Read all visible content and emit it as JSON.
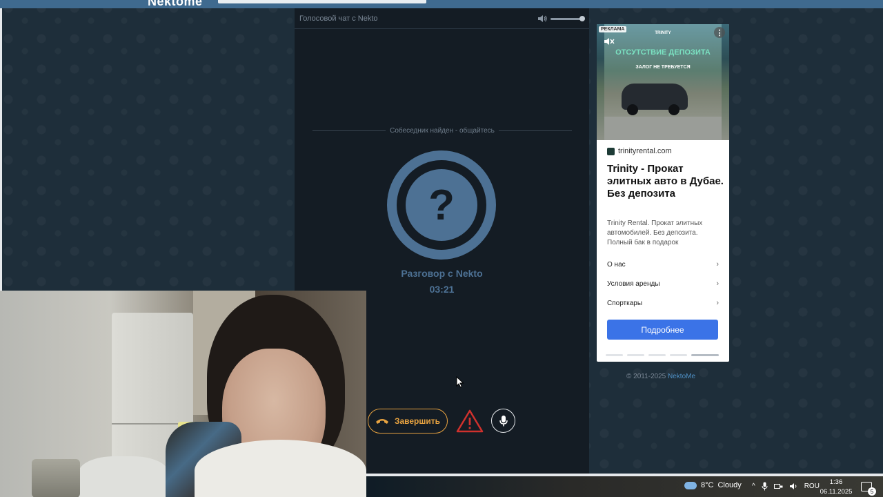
{
  "topbar": {
    "logo": "Nektome"
  },
  "chat": {
    "title": "Голосовой чат с Nekto",
    "status": "Собеседник найден - общайтесь",
    "avatar_symbol": "?",
    "conversation_title": "Разговор с Nekto",
    "timer": "03:21",
    "end_button_label": "Завершить",
    "volume_percent": 100
  },
  "ad": {
    "badge": "РЕКЛАМА",
    "image_brand": "TRINITY",
    "image_headline": "ОТСУТСТВИЕ ДЕПОЗИТА",
    "image_subheadline": "ЗАЛОГ НЕ ТРЕБУЕТСЯ",
    "domain": "trinityrental.com",
    "title": "Trinity - Прокат элитных авто в Дубае. Без депозита",
    "description": "Trinity Rental. Прокат элитных автомобилей. Без депозита. Полный бак в подарок",
    "links": [
      {
        "label": "О нас"
      },
      {
        "label": "Условия аренды"
      },
      {
        "label": "Спорткары"
      }
    ],
    "cta": "Подробнее"
  },
  "footer": {
    "copyright": "© 2011-2025",
    "brand_link": "NektoMe"
  },
  "taskbar": {
    "temperature": "8°C",
    "weather": "Cloudy",
    "language": "ROU",
    "time": "1:36",
    "date": "06.11.2025",
    "notification_count": "5"
  }
}
